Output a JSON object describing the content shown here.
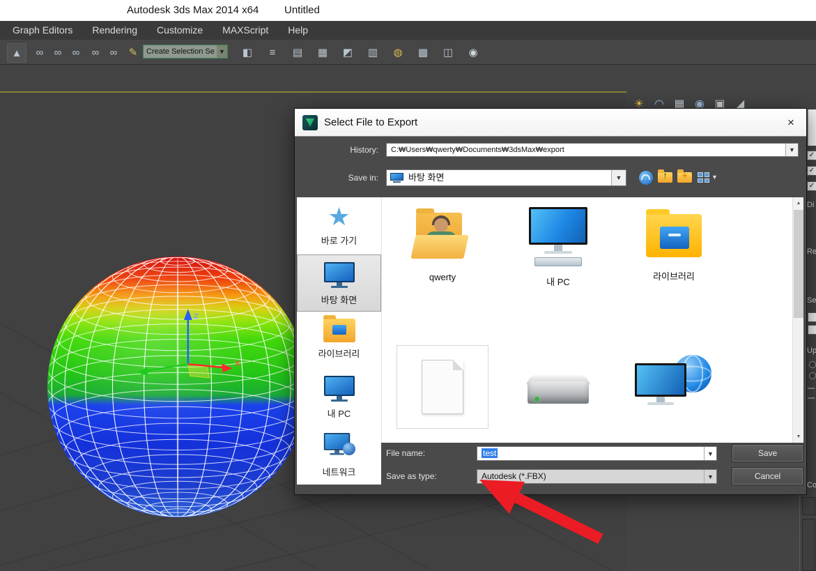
{
  "window": {
    "app_title": "Autodesk 3ds Max  2014 x64",
    "doc_title": "Untitled"
  },
  "menubar": {
    "items": [
      "Graph Editors",
      "Rendering",
      "Customize",
      "MAXScript",
      "Help"
    ]
  },
  "toolbar": {
    "selection_set_value": "Create Selection Se"
  },
  "viewport": {
    "axis_x_label": "X",
    "axis_z_label": "Z"
  },
  "right_panel": {
    "fragments": [
      "Di",
      "Re",
      "Se",
      "Up",
      "Co"
    ]
  },
  "dialog": {
    "title": "Select File to Export",
    "history_label": "History:",
    "history_value": "C:₩Users₩qwerty₩Documents₩3dsMax₩export",
    "save_in_label": "Save in:",
    "save_in_value": "바탕 화면",
    "places": [
      {
        "label": "바로 가기"
      },
      {
        "label": "바탕 화면"
      },
      {
        "label": "라이브러리"
      },
      {
        "label": "내 PC"
      },
      {
        "label": "네트워크"
      }
    ],
    "files": [
      {
        "label": "qwerty"
      },
      {
        "label": "내 PC"
      },
      {
        "label": "라이브러리"
      }
    ],
    "file_name_label": "File name:",
    "file_name_value": "test",
    "save_as_type_label": "Save as type:",
    "save_as_type_value": "Autodesk (*.FBX)",
    "save_button": "Save",
    "cancel_button": "Cancel"
  },
  "colors": {
    "accent_blue": "#2f7fe8",
    "viewport_border": "#85852f",
    "arrow_red": "#ec1c24"
  }
}
